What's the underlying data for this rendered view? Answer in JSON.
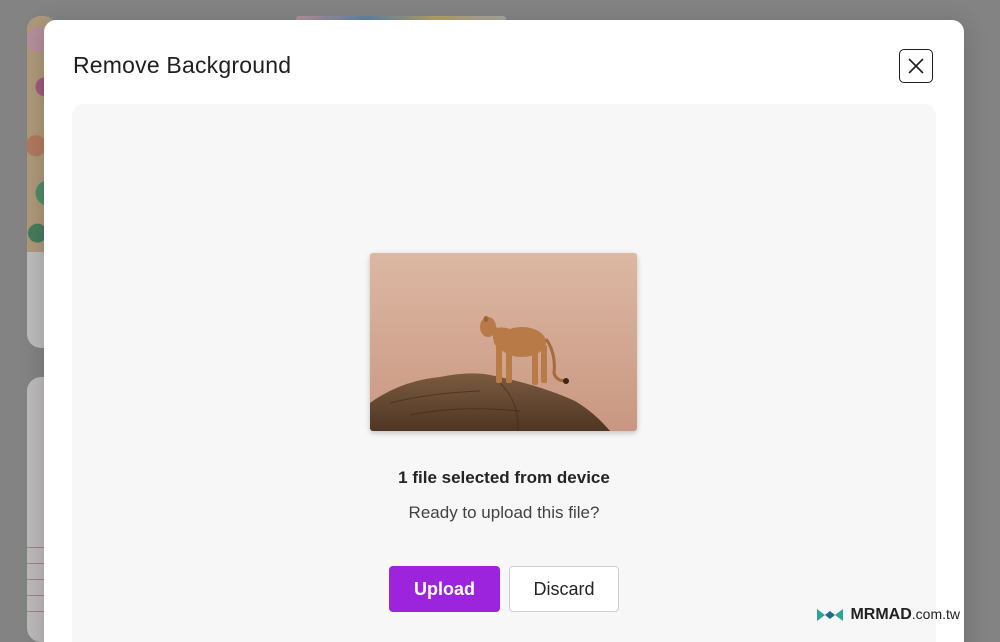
{
  "dialog": {
    "title": "Remove Background",
    "close_icon": "close-icon"
  },
  "preview": {
    "subject": "lioness standing on a rock"
  },
  "status": {
    "title": "1 file selected from device",
    "subtitle": "Ready to upload this file?"
  },
  "actions": {
    "upload_label": "Upload",
    "discard_label": "Discard"
  },
  "watermark": {
    "brand": "MRMAD",
    "tld": ".com.tw"
  },
  "colors": {
    "accent": "#9b24dc",
    "overlay": "#8d8d8d"
  }
}
